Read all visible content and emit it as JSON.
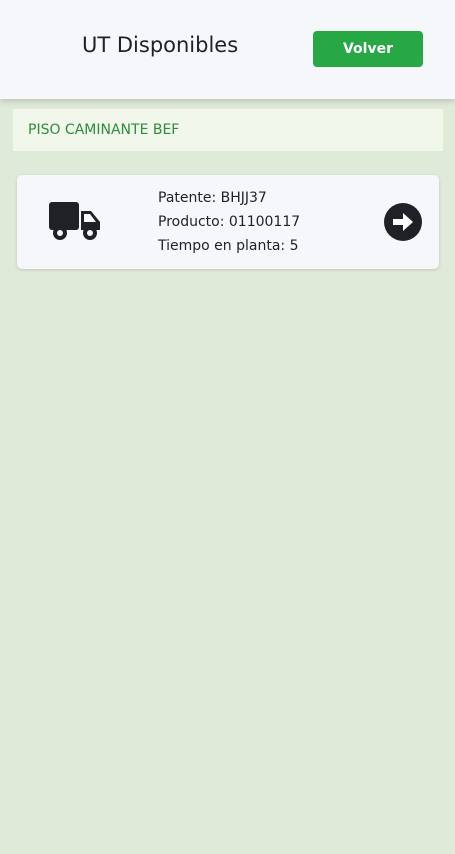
{
  "header": {
    "title": "UT Disponibles",
    "back_label": "Volver"
  },
  "section": {
    "label": "PISO CAMINANTE BEF"
  },
  "units": [
    {
      "patente": "Patente: BHJJ37",
      "producto": "Producto: 01100117",
      "tiempo": "Tiempo en planta: 5",
      "icon": "truck-icon",
      "action_icon": "arrow-right-circle-icon"
    }
  ],
  "colors": {
    "background": "#e0ead9",
    "header_bg": "#f6f7fa",
    "accent_green": "#28a745",
    "section_text": "#2e8b3b",
    "section_bg": "#f1f7ea",
    "icon_dark": "#1f2126"
  }
}
